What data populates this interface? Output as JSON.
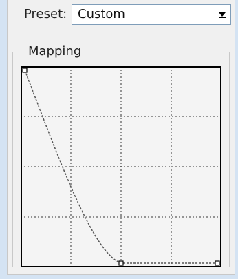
{
  "preset": {
    "label_first": "P",
    "label_rest": "reset:",
    "value": "Custom",
    "dropdown_icon": "chevron-down-icon"
  },
  "mapping": {
    "group_label": "Mapping",
    "grid_divisions": 4,
    "curve_points": [
      {
        "input": 0.0,
        "output": 1.0
      },
      {
        "input": 0.5,
        "output": 0.0
      },
      {
        "input": 1.0,
        "output": 0.0
      }
    ]
  },
  "colors": {
    "panel_bg": "#f0f0f0",
    "outer_bg": "#d4e3f3",
    "graph_border": "#000000",
    "curve": "#555555"
  }
}
